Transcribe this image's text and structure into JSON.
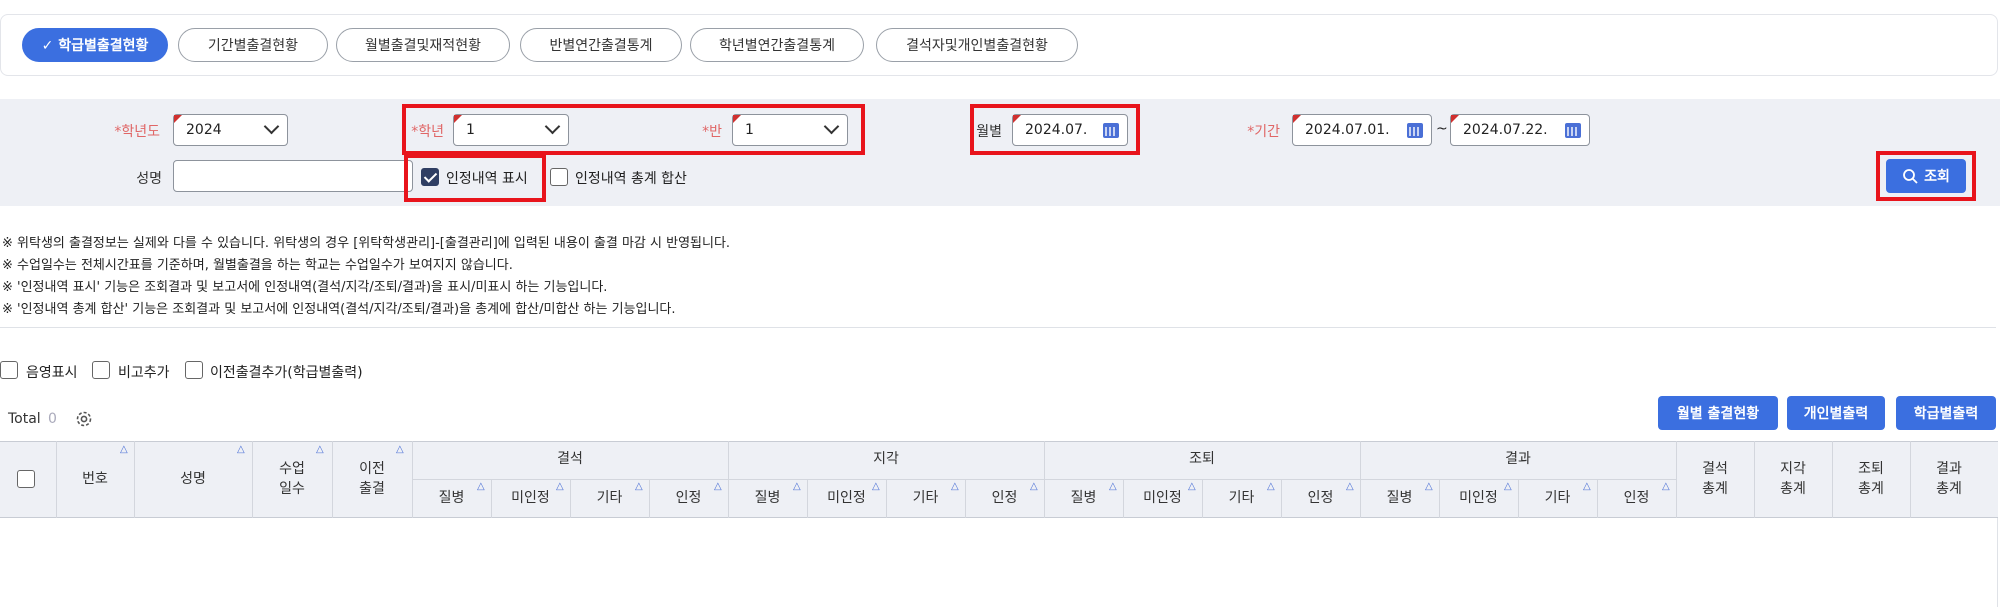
{
  "tabs": [
    {
      "label": "✓ 학급별출결현황",
      "active": true
    },
    {
      "label": "기간별출결현황"
    },
    {
      "label": "월별출결및재적현황"
    },
    {
      "label": "반별연간출결통계"
    },
    {
      "label": "학년별연간출결통계"
    },
    {
      "label": "결석자및개인별출결현황"
    }
  ],
  "filters": {
    "school_year_label": "*학년도",
    "school_year_value": "2024",
    "grade_label": "*학년",
    "grade_value": "1",
    "class_label": "*반",
    "class_value": "1",
    "month_label": "월별",
    "month_value": "2024.07.",
    "period_label": "*기간",
    "period_start": "2024.07.01.",
    "period_tilde": "~",
    "period_end": "2024.07.22.",
    "name_label": "성명",
    "name_value": "",
    "show_approved_label": "인정내역 표시",
    "sum_approved_label": "인정내역 총계 합산",
    "search_label": "조회"
  },
  "notes": [
    "※ 위탁생의 출결정보는 실제와 다를 수 있습니다. 위탁생의 경우 [위탁학생관리]-[출결관리]에 입력된 내용이 출결 마감 시 반영됩니다.",
    "※ 수업일수는 전체시간표를 기준하며, 월별출결을 하는 학교는 수업일수가 보여지지 않습니다.",
    "※ '인정내역 표시' 기능은 조회결과 및 보고서에 인정내역(결석/지각/조퇴/결과)을 표시/미표시 하는 기능입니다.",
    "※ '인정내역 총계 합산' 기능은 조회결과 및 보고서에 인정내역(결석/지각/조퇴/결과)을 총계에 합산/미합산 하는 기능입니다."
  ],
  "options": {
    "a": "음영표시",
    "b": "비고추가",
    "c": "이전출결추가(학급별출력)"
  },
  "toolbar": {
    "total_label": "Total",
    "total_count": "0",
    "monthly_btn": "월별 출결현황",
    "personal_btn": "개인별출력",
    "class_btn": "학급별출력"
  },
  "table": {
    "col_no": "번호",
    "col_name": "성명",
    "col_days_1": "수업",
    "col_days_2": "일수",
    "col_prev_1": "이전",
    "col_prev_2": "출결",
    "groups": [
      "결석",
      "지각",
      "조퇴",
      "결과"
    ],
    "subs": [
      "질병",
      "미인정",
      "기타",
      "인정"
    ],
    "totals": [
      [
        "결석",
        "총계"
      ],
      [
        "지각",
        "총계"
      ],
      [
        "조퇴",
        "총계"
      ],
      [
        "결과",
        "총계"
      ]
    ],
    "sort_glyph": "△"
  }
}
